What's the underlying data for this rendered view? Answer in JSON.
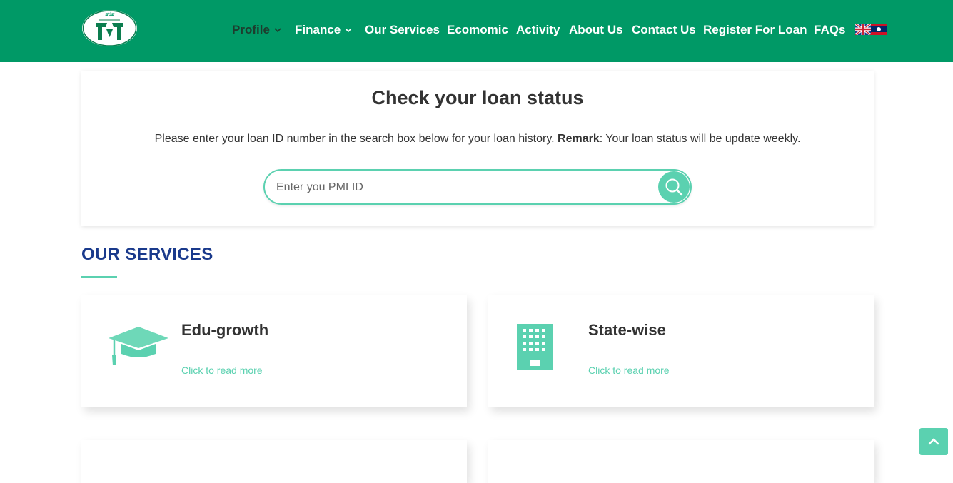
{
  "brand": {
    "logo_text": "ສປສ",
    "logo_subtext": "PMI",
    "logo_icon": "pmi-logo",
    "color_primary": "#009966",
    "color_accent": "#5bd1b0",
    "color_heading": "#1a3a8c"
  },
  "nav": {
    "items": [
      {
        "label": "Profile",
        "has_dropdown": true,
        "active": true
      },
      {
        "label": "Finance",
        "has_dropdown": true,
        "active": false
      },
      {
        "label": "Our Services",
        "has_dropdown": false,
        "active": false
      },
      {
        "label": "Ecomomic",
        "has_dropdown": false,
        "active": false
      },
      {
        "label": "Activity",
        "has_dropdown": false,
        "active": false
      },
      {
        "label": "About Us",
        "has_dropdown": false,
        "active": false
      },
      {
        "label": "Contact Us",
        "has_dropdown": false,
        "active": false
      },
      {
        "label": "Register For Loan",
        "has_dropdown": false,
        "active": false
      },
      {
        "label": "FAQs",
        "has_dropdown": false,
        "active": false
      }
    ],
    "languages": [
      "english-flag-icon",
      "lao-flag-icon"
    ]
  },
  "loan_status": {
    "title": "Check your loan status",
    "description": "Please enter your loan ID number in the search box below for your loan history.",
    "remark_label": "Remark",
    "remark_text": ": Your loan status will be update weekly.",
    "search_placeholder": "Enter you PMI ID",
    "search_value": "",
    "search_icon": "search-icon"
  },
  "services": {
    "heading": "OUR SERVICES",
    "items": [
      {
        "title": "Edu-growth",
        "link": "Click to read more",
        "icon": "graduation-cap-icon"
      },
      {
        "title": "State-wise",
        "link": "Click to read more",
        "icon": "building-icon"
      }
    ]
  },
  "back_to_top_icon": "chevron-up-icon"
}
